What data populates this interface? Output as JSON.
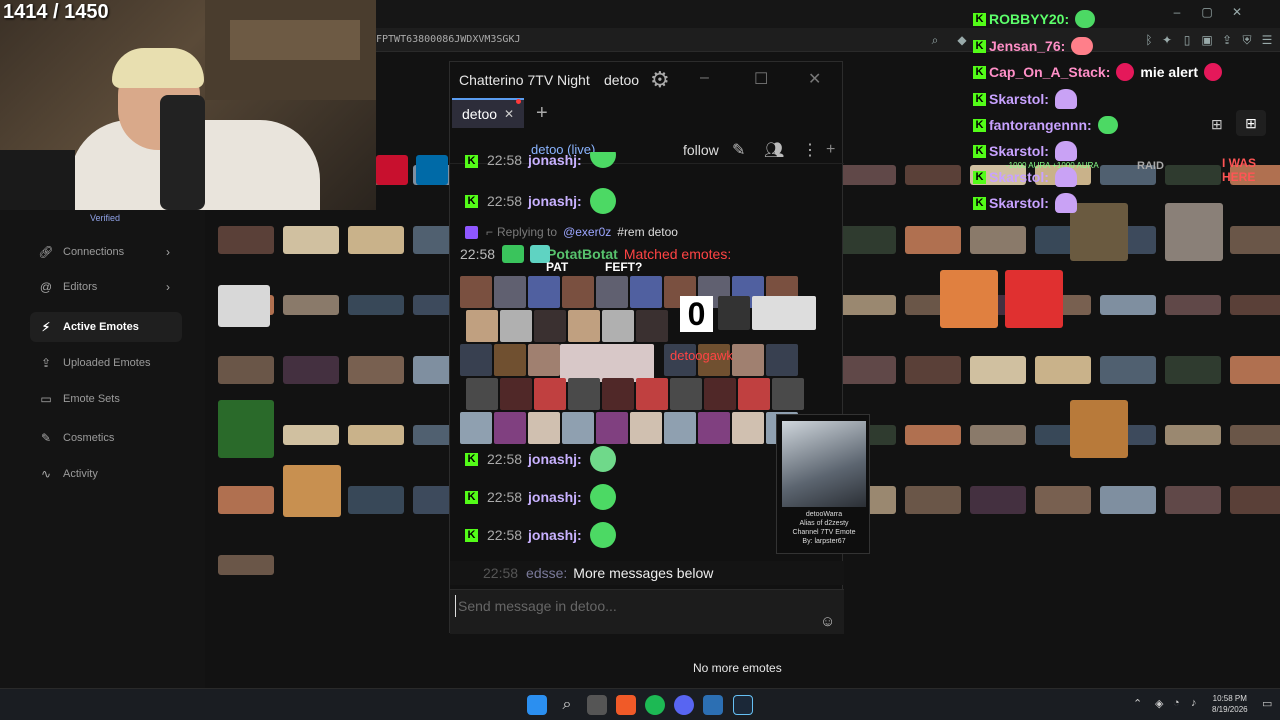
{
  "stream": {
    "counter": "1414 / 1450"
  },
  "browser": {
    "url": "FPTWT63800086JWDXVM3SGKJ"
  },
  "site": {
    "verified": "Verified",
    "sidebar": [
      {
        "label": "Connections",
        "icon": "link-icon",
        "chevron": true
      },
      {
        "label": "Editors",
        "icon": "at-icon",
        "chevron": true
      },
      {
        "label": "Active Emotes",
        "icon": "lightning-icon",
        "active": true
      },
      {
        "label": "Uploaded Emotes",
        "icon": "upload-icon"
      },
      {
        "label": "Emote Sets",
        "icon": "folder-icon"
      },
      {
        "label": "Cosmetics",
        "icon": "brush-icon"
      },
      {
        "label": "Activity",
        "icon": "activity-icon"
      }
    ],
    "no_more_emotes": "No more emotes",
    "raid_badge": "RAID",
    "aura_text": "-1000 AURA  +1000 AURA",
    "hover_text": "I WAS HERE"
  },
  "overlay": [
    {
      "user": "ROBBYY20:",
      "color": "green",
      "emote": "frog"
    },
    {
      "user": "Jensan_76:",
      "color": "pink",
      "emote": "red"
    },
    {
      "user": "Cap_On_A_Stack:",
      "color": "pink",
      "text": "mie alert",
      "emote": "alert"
    },
    {
      "user": "Skarstol:",
      "color": "purple",
      "emote": "ghost"
    },
    {
      "user": "fantorangennn:",
      "color": "purple",
      "emote": "frog"
    },
    {
      "user": "Skarstol:",
      "color": "purple",
      "emote": "ghost"
    },
    {
      "user": "Skarstol:",
      "color": "purple",
      "emote": "ghost"
    },
    {
      "user": "Skarstol:",
      "color": "purple",
      "emote": "ghost"
    }
  ],
  "chatterino": {
    "title": "Chatterino 7TV Night",
    "user": "detoo",
    "tab": "detoo",
    "channel": "detoo (live)",
    "follow": "follow",
    "messages": [
      {
        "time": "22:58",
        "user": "jonashj:"
      },
      {
        "time": "22:58",
        "user": "jonashj:"
      },
      {
        "time": "22:58",
        "user": "jonashj:"
      },
      {
        "time": "22:58",
        "user": "jonashj:"
      }
    ],
    "reply": {
      "label": "Replying to",
      "mention": "@exer0z",
      "command": "#rem detoo"
    },
    "bot": {
      "time": "22:58",
      "name": "PotatBotat",
      "text": "Matched emotes:"
    },
    "wall_zero": "0",
    "wall_red": "detoogawk",
    "wall_caption_1": "FEFT?",
    "wall_caption_2": "PAT",
    "tooltip": {
      "name": "detooWarra",
      "alias": "Alias of d2zesty",
      "kind": "Channel 7TV Emote",
      "by": "By: larpster67"
    },
    "more_below": {
      "time": "22:58",
      "user": "edsse:",
      "text": "More messages below"
    },
    "input_placeholder": "Send message in detoo..."
  },
  "taskbar": {
    "time": "10:58 PM",
    "date": "8/19/2026"
  }
}
